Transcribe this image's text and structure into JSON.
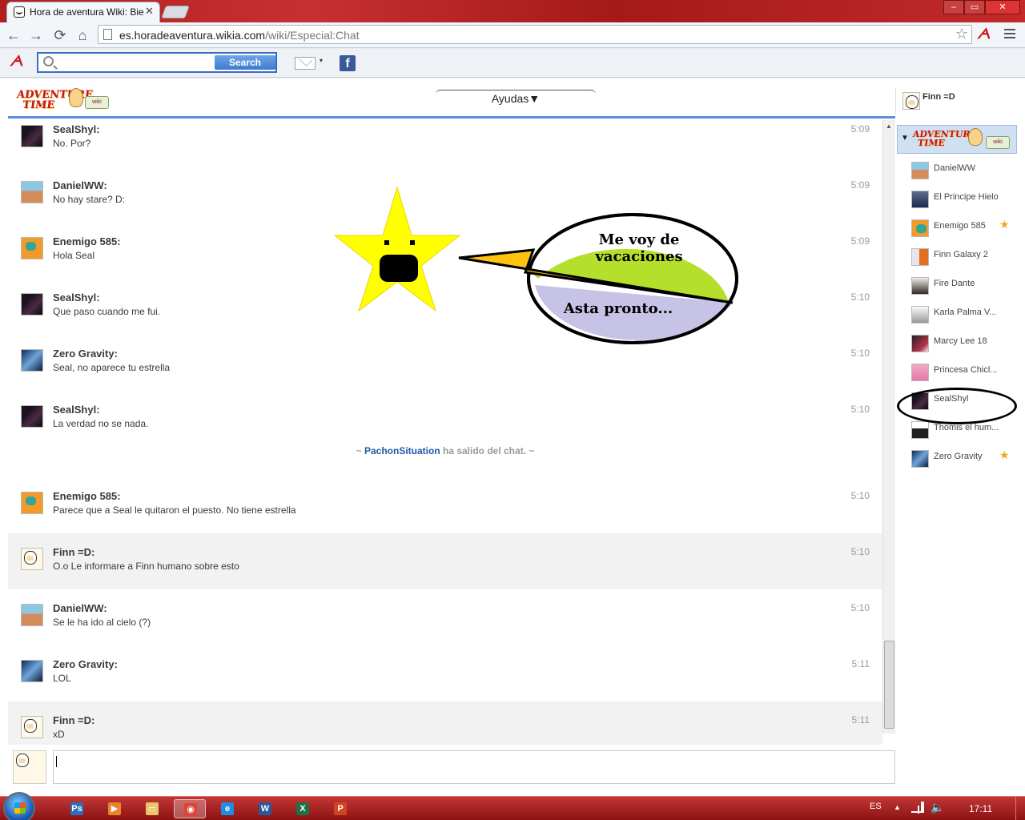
{
  "browser": {
    "tab_title": "Hora de aventura Wiki: Bie",
    "tab_close": "✕",
    "url_host": "es.horadeaventura.wikia.com",
    "url_path": "/wiki/Especial:Chat",
    "window_controls": {
      "minimize": "–",
      "maximize": "▭",
      "close": "✕"
    }
  },
  "nav": {
    "back": "←",
    "forward": "→",
    "reload": "⟳",
    "home": "⌂",
    "bookmark": "☆"
  },
  "extension_bar": {
    "search_placeholder": "",
    "search_button": "Search",
    "mail_caret": "▾",
    "facebook": "f"
  },
  "chat_header": {
    "logo_line1": "ADVENTURE",
    "logo_line2": "TIME",
    "logo_badge": "wiki",
    "menu_label": "Ayudas▼"
  },
  "current_user": {
    "name": "Finn =D"
  },
  "messages": [
    {
      "author": "SealShyl:",
      "text": "No. Por?",
      "time": "5:09",
      "avatar": "dark",
      "self": false
    },
    {
      "author": "DanielWW:",
      "text": "No hay stare? D:",
      "time": "5:09",
      "avatar": "daniel",
      "self": false
    },
    {
      "author": "Enemigo 585:",
      "text": "Hola Seal",
      "time": "5:09",
      "avatar": "enemigo",
      "self": false
    },
    {
      "author": "SealShyl:",
      "text": "Que paso cuando me fui.",
      "time": "5:10",
      "avatar": "dark",
      "self": false
    },
    {
      "author": "Zero Gravity:",
      "text": "Seal, no aparece tu estrella",
      "time": "5:10",
      "avatar": "zero",
      "self": false
    },
    {
      "author": "SealShyl:",
      "text": "La verdad no se nada.",
      "time": "5:10",
      "avatar": "dark",
      "self": false
    },
    {
      "author": "Enemigo 585:",
      "text": "Parece que a Seal le quitaron el puesto. No tiene estrella",
      "time": "5:10",
      "avatar": "enemigo",
      "self": false
    },
    {
      "author": "Finn =D:",
      "text": "O.o Le informare a Finn humano sobre esto",
      "time": "5:10",
      "avatar": "finn",
      "self": true
    },
    {
      "author": "DanielWW:",
      "text": "Se le ha ido al cielo (?)",
      "time": "5:10",
      "avatar": "daniel",
      "self": false
    },
    {
      "author": "Zero Gravity:",
      "text": "LOL",
      "time": "5:11",
      "avatar": "zero",
      "self": false
    },
    {
      "author": "Finn =D:",
      "text": "xD",
      "time": "5:11",
      "avatar": "finn",
      "self": true
    }
  ],
  "inline_alert": {
    "prefix": "~ ",
    "user": "PachonSituation",
    "suffix": " ha salido del chat. ~"
  },
  "userlist": [
    {
      "name": "DanielWW",
      "avatar": "daniel",
      "star": false
    },
    {
      "name": "El Principe Hielo",
      "avatar": "hielo",
      "star": false
    },
    {
      "name": "Enemigo 585",
      "avatar": "enemigo",
      "star": true
    },
    {
      "name": "Finn Galaxy 2",
      "avatar": "galaxy",
      "star": false
    },
    {
      "name": "Fire Dante",
      "avatar": "dante",
      "star": false
    },
    {
      "name": "Karla Palma V...",
      "avatar": "karla",
      "star": false
    },
    {
      "name": "Marcy Lee 18",
      "avatar": "marcy",
      "star": false
    },
    {
      "name": "Princesa Chicl...",
      "avatar": "chicle",
      "star": false
    },
    {
      "name": "SealShyl",
      "avatar": "dark",
      "star": false
    },
    {
      "name": "Thomis el hum...",
      "avatar": "thomis",
      "star": false
    },
    {
      "name": "Zero Gravity",
      "avatar": "zero",
      "star": true
    }
  ],
  "star_glyph": "★",
  "drawing": {
    "bubble_text_top_1": "Me voy de",
    "bubble_text_top_2": "vacaciones",
    "bubble_text_bottom": "Asta pronto...",
    "colors": {
      "star": "#ffff00",
      "bubble_top": "#b4e02c",
      "bubble_bottom": "#c7c3e6",
      "pointer": "#ffc20e"
    }
  },
  "taskbar": {
    "apps": [
      "psd",
      "media",
      "folder",
      "chrome",
      "ie",
      "word",
      "excel",
      "powerpoint"
    ],
    "app_labels": {
      "psd": "Ps",
      "word": "W",
      "excel": "X",
      "powerpoint": "P"
    },
    "language": "ES",
    "tray_up": "▲",
    "sound": "🔈",
    "clock": "17:11"
  }
}
